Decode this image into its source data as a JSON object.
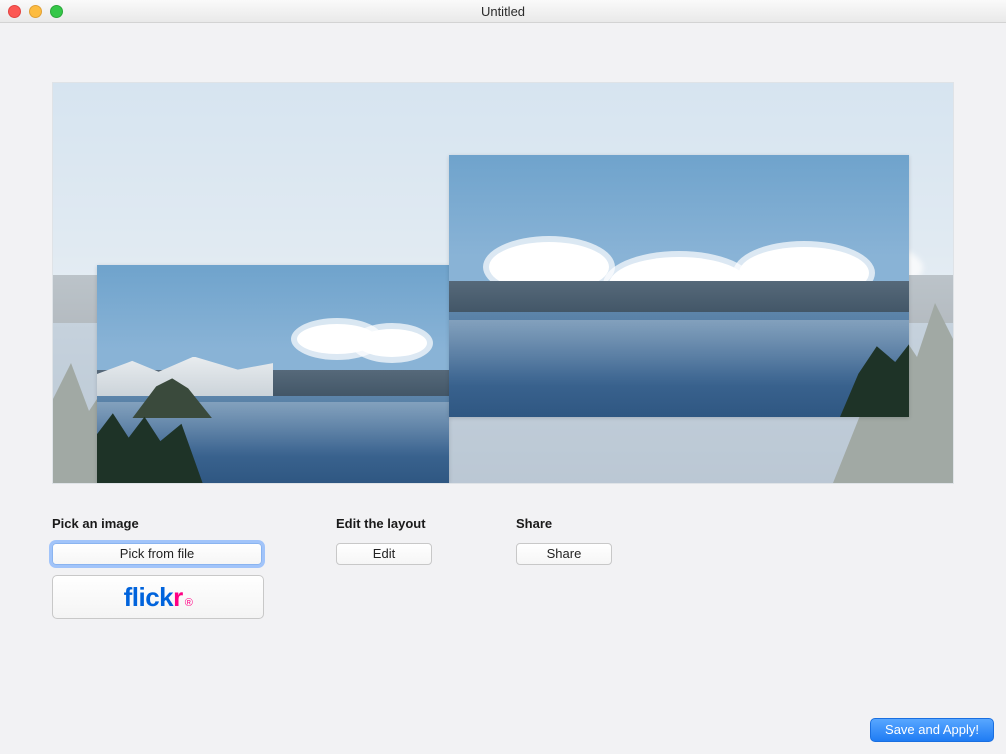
{
  "window": {
    "title": "Untitled"
  },
  "sections": {
    "pick": {
      "label": "Pick an image",
      "pick_from_file_label": "Pick from file",
      "flickr_label": "flickr"
    },
    "edit": {
      "label": "Edit the layout",
      "edit_button_label": "Edit"
    },
    "share": {
      "label": "Share",
      "share_button_label": "Share"
    }
  },
  "footer": {
    "save_apply_label": "Save and Apply!"
  },
  "colors": {
    "flickr_blue": "#0063dc",
    "flickr_pink": "#ff0084",
    "primary_button": "#1f7cf4"
  }
}
